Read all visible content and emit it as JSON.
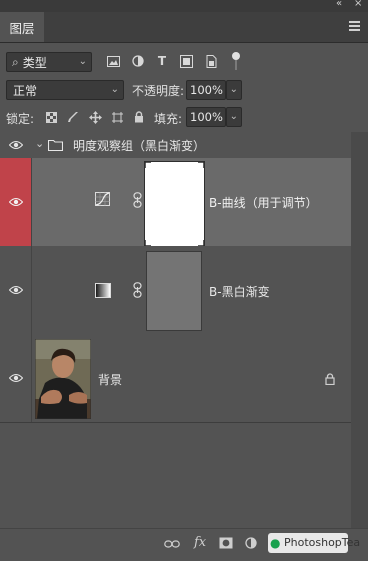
{
  "panel": {
    "tab_label": "图层",
    "collapse_glyph": "«",
    "close_glyph": "×"
  },
  "filter": {
    "search_symbol": "⌕",
    "kind_label": "类型",
    "icons": [
      "image-filter-icon",
      "adjustment-filter-icon",
      "type-filter-icon",
      "shape-filter-icon",
      "smart-object-filter-icon"
    ]
  },
  "blend": {
    "mode": "正常",
    "opacity_label": "不透明度:",
    "opacity_value": "100%"
  },
  "lock": {
    "label": "锁定:",
    "fill_label": "填充:",
    "fill_value": "100%"
  },
  "layers": {
    "group": {
      "name": "明度观察组（黑白渐变）"
    },
    "curves": {
      "name": "B-曲线（用于调节）"
    },
    "gradient": {
      "name": "B-黑白渐变"
    },
    "background": {
      "name": "背景"
    }
  },
  "footer": {
    "fx_label": "fx",
    "watermark": "PhotoshopTea"
  },
  "colors": {
    "panel_bg": "#535353",
    "selected_row": "#6a6a6a",
    "eye_highlight": "#c0434a"
  }
}
